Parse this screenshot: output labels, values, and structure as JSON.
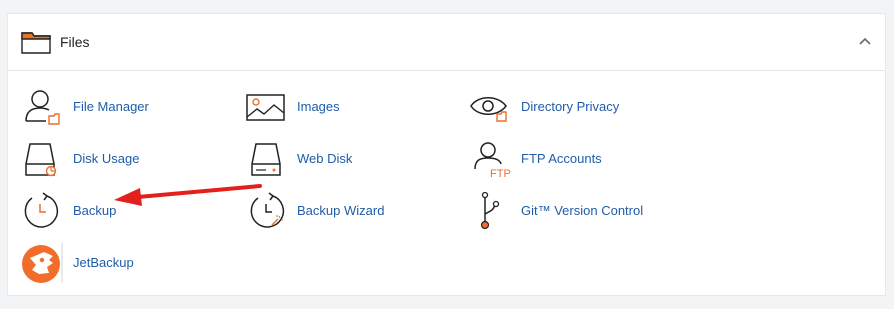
{
  "section": {
    "title": "Files",
    "folder_icon": "folder-icon",
    "collapse_icon": "chevron-up-icon"
  },
  "items": [
    {
      "label": "File Manager",
      "icon": "file-manager-icon"
    },
    {
      "label": "Images",
      "icon": "images-icon"
    },
    {
      "label": "Directory Privacy",
      "icon": "directory-privacy-icon"
    },
    {
      "label": "Disk Usage",
      "icon": "disk-usage-icon"
    },
    {
      "label": "Web Disk",
      "icon": "web-disk-icon"
    },
    {
      "label": "FTP Accounts",
      "icon": "ftp-accounts-icon"
    },
    {
      "label": "Backup",
      "icon": "backup-icon"
    },
    {
      "label": "Backup Wizard",
      "icon": "backup-wizard-icon"
    },
    {
      "label": "Git™ Version Control",
      "icon": "git-icon"
    },
    {
      "label": "JetBackup",
      "icon": "jetbackup-icon"
    }
  ],
  "colors": {
    "accent_orange": "#e8712b",
    "link_blue": "#1f5da8",
    "annotation_red": "#e3201c",
    "jetbackup_orange": "#f26c2b"
  },
  "annotation": {
    "type": "red-arrow",
    "target": "Backup"
  }
}
